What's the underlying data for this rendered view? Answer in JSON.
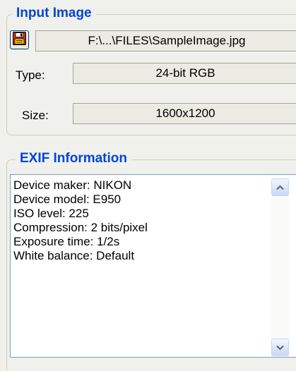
{
  "input_image": {
    "group_title": "Input Image",
    "save_icon": "floppy-disk-icon",
    "path": "F:\\...\\FILES\\SampleImage.jpg",
    "type_label": "Type:",
    "type_value": "24-bit RGB",
    "size_label": "Size:",
    "size_value": "1600x1200"
  },
  "exif": {
    "group_title": "EXIF Information",
    "lines": [
      "Device maker: NIKON",
      "Device model: E950",
      "ISO level: 225",
      "Compression: 2 bits/pixel",
      "Exposure time: 1/2s",
      "White balance: Default"
    ],
    "scroll_up_icon": "chevron-up-icon",
    "scroll_down_icon": "chevron-down-icon"
  },
  "colors": {
    "group_title": "#0046d5",
    "save_icon_red": "#d42a1a",
    "save_icon_accent": "#ffd800"
  }
}
